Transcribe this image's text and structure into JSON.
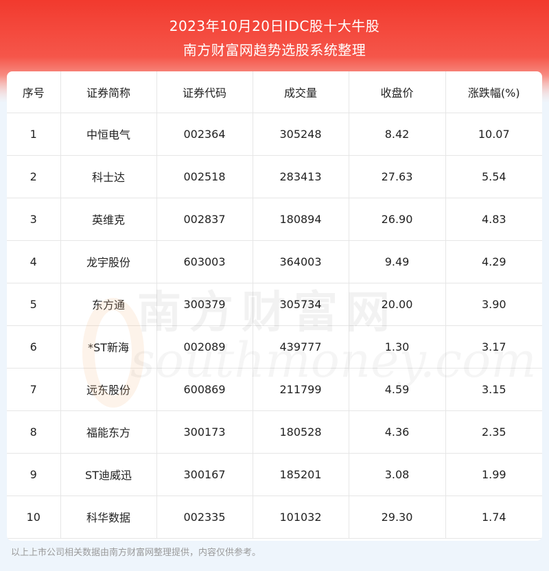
{
  "header": {
    "title_line1": "2023年10月20日IDC股十大牛股",
    "title_line2": "南方财富网趋势选股系统整理"
  },
  "table": {
    "columns": [
      "序号",
      "证券简称",
      "证券代码",
      "成交量",
      "收盘价",
      "涨跌幅(%)"
    ],
    "rows": [
      [
        "1",
        "中恒电气",
        "002364",
        "305248",
        "8.42",
        "10.07"
      ],
      [
        "2",
        "科士达",
        "002518",
        "283413",
        "27.63",
        "5.54"
      ],
      [
        "3",
        "英维克",
        "002837",
        "180894",
        "26.90",
        "4.83"
      ],
      [
        "4",
        "龙宇股份",
        "603003",
        "364003",
        "9.49",
        "4.29"
      ],
      [
        "5",
        "东方通",
        "300379",
        "305734",
        "20.00",
        "3.90"
      ],
      [
        "6",
        "*ST新海",
        "002089",
        "439777",
        "1.30",
        "3.17"
      ],
      [
        "7",
        "远东股份",
        "600869",
        "211799",
        "4.59",
        "3.15"
      ],
      [
        "8",
        "福能东方",
        "300173",
        "180528",
        "4.36",
        "2.35"
      ],
      [
        "9",
        "ST迪威迅",
        "300167",
        "185201",
        "3.08",
        "1.99"
      ],
      [
        "10",
        "科华数据",
        "002335",
        "101032",
        "29.30",
        "1.74"
      ]
    ]
  },
  "watermark": {
    "cn": "南方财富网",
    "en": "southmoney.com"
  },
  "footer": {
    "note": "以上上市公司相关数据由南方财富网整理提供，内容仅供参考。"
  },
  "colors": {
    "header_red": "#f23a2e",
    "background": "#eef5fc"
  }
}
